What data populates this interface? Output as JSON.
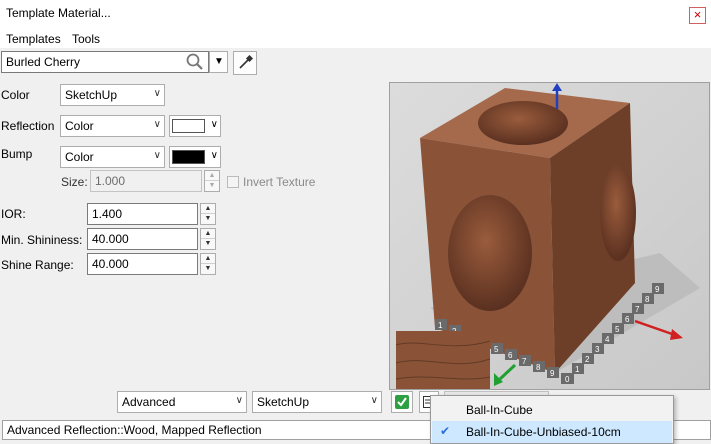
{
  "window": {
    "title": "Template Material...",
    "close_label": "×"
  },
  "menu": {
    "items": [
      {
        "label": "Templates"
      },
      {
        "label": "Tools"
      }
    ]
  },
  "material": {
    "name": "Burled Cherry"
  },
  "props": {
    "color_label": "Color",
    "color_value": "SketchUp",
    "reflection_label": "Reflection",
    "reflection_value": "Color",
    "reflection_swatch": "#ffffff",
    "bump_label": "Bump",
    "bump_value": "Color",
    "bump_swatch": "#000000",
    "size_label": "Size:",
    "size_value": "1.000",
    "invert_label": "Invert Texture",
    "ior_label": "IOR:",
    "ior_value": "1.400",
    "shininess_label": "Min. Shininess:",
    "shininess_value": "40.000",
    "range_label": "Shine Range:",
    "range_value": "40.000"
  },
  "bottom": {
    "mode_value": "Advanced",
    "engine_value": "SketchUp"
  },
  "status": {
    "text": "Advanced Reflection::Wood, Mapped Reflection"
  },
  "dropdown": {
    "items": [
      {
        "label": "Ball-In-Cube",
        "selected": false
      },
      {
        "label": "Ball-In-Cube-Unbiased-10cm",
        "selected": true,
        "check": "✔"
      }
    ]
  },
  "preview": {
    "front_ticks": [
      "1",
      "2",
      "3",
      "4",
      "5",
      "6",
      "7",
      "8",
      "9",
      "0"
    ],
    "side_ticks": [
      "9",
      "8",
      "7",
      "6",
      "5",
      "4",
      "3",
      "2",
      "1",
      "0"
    ]
  },
  "colors": {
    "wood_front": "#8a5338",
    "wood_side": "#6e3f28",
    "wood_top": "#a56a4b",
    "axis_blue": "#2040c0",
    "axis_red": "#d02020",
    "axis_green": "#20a030"
  },
  "icons": {
    "search": "search-icon",
    "eyedropper": "eyedropper-icon",
    "apply": "checkmark-icon",
    "scene": "scene-icon"
  }
}
